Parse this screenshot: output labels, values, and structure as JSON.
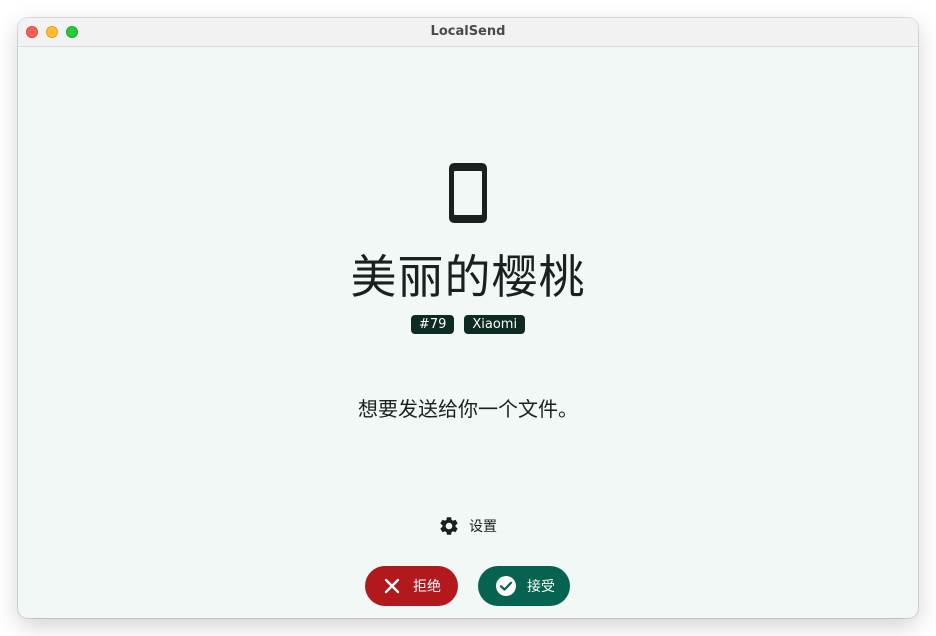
{
  "window": {
    "title": "LocalSend"
  },
  "device": {
    "icon": "smartphone-icon",
    "name": "美丽的樱桃",
    "tags": [
      "#79",
      "Xiaomi"
    ]
  },
  "message": "想要发送给你一个文件。",
  "settings": {
    "icon": "gear-icon",
    "label": "设置"
  },
  "actions": {
    "decline": {
      "label": "拒绝",
      "icon": "close-icon",
      "color": "#b3181c"
    },
    "accept": {
      "label": "接受",
      "icon": "check-circle-icon",
      "color": "#05634f"
    }
  },
  "colors": {
    "background": "#f1f8f5",
    "tag_bg": "#0d2b22"
  }
}
